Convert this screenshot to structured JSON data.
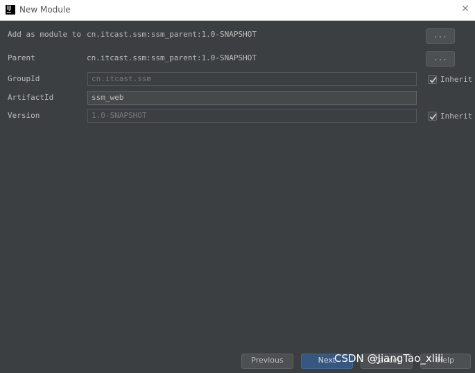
{
  "window": {
    "title": "New Module",
    "logo_text": "IJ",
    "close_glyph": "✕"
  },
  "form": {
    "add_as_module": {
      "label": "Add as module to",
      "value": "cn.itcast.ssm:ssm_parent:1.0-SNAPSHOT",
      "button": "..."
    },
    "parent": {
      "label": "Parent",
      "value": "cn.itcast.ssm:ssm_parent:1.0-SNAPSHOT",
      "button": "..."
    },
    "group_id": {
      "label": "GroupId",
      "value": "cn.itcast.ssm",
      "inherit_label": "Inherit",
      "inherit_checked": true
    },
    "artifact_id": {
      "label": "ArtifactId",
      "value": "ssm_web"
    },
    "version": {
      "label": "Version",
      "value": "1.0-SNAPSHOT",
      "inherit_label": "Inherit",
      "inherit_checked": true
    }
  },
  "footer": {
    "previous": "Previous",
    "next": "Next",
    "cancel": "Cancel",
    "help": "Help"
  },
  "watermark": "CSDN @JiangTao_xlili",
  "colors": {
    "background": "#3c3f41",
    "primary_button": "#365880",
    "text": "#bbbbbb"
  }
}
